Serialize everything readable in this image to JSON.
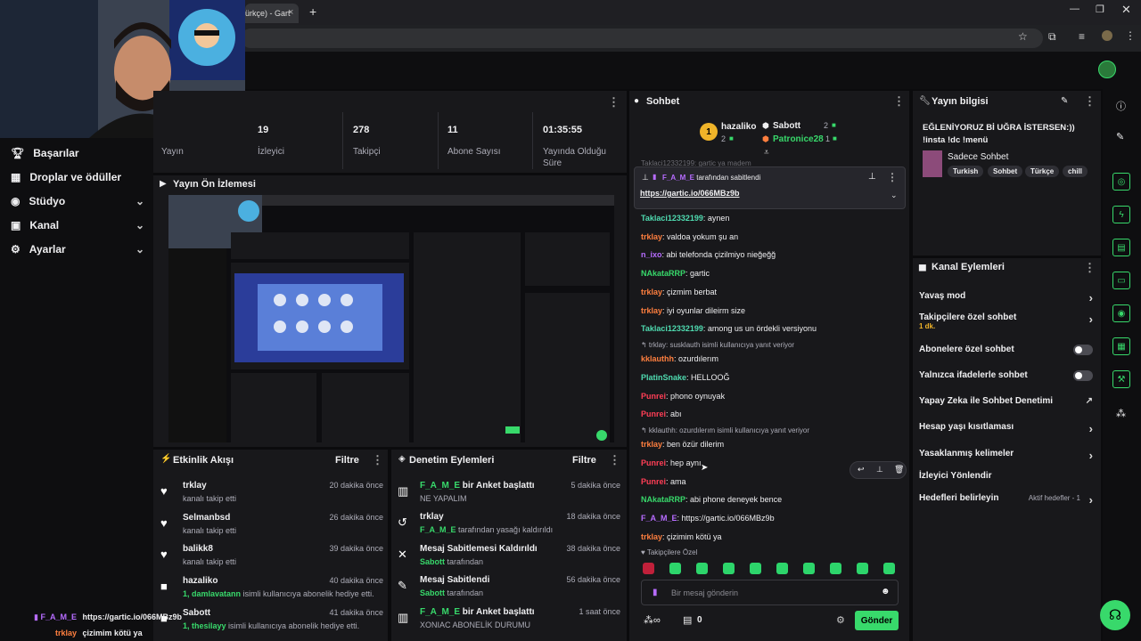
{
  "browser": {
    "tab_title": "ürkçe) - Gart",
    "new_tab": "+"
  },
  "left_nav": {
    "items": [
      {
        "label": "Başarılar",
        "icon": "trophy-icon"
      },
      {
        "label": "Droplar ve ödüller",
        "icon": "gift-icon"
      },
      {
        "label": "Stüdyo",
        "icon": "studio-icon",
        "chev": "⌄"
      },
      {
        "label": "Kanal",
        "icon": "channel-icon",
        "chev": "⌄"
      },
      {
        "label": "Ayarlar",
        "icon": "gear-icon",
        "chev": "⌄"
      }
    ]
  },
  "stats": {
    "stream_label": "Yayın",
    "items": [
      {
        "value": "19",
        "label": "İzleyici"
      },
      {
        "value": "278",
        "label": "Takipçi"
      },
      {
        "value": "11",
        "label": "Abone Sayısı"
      },
      {
        "value": "01:35:55",
        "label": "Yayında Olduğu Süre"
      }
    ]
  },
  "preview": {
    "title": "Yayın Ön İzlemesi"
  },
  "activity": {
    "title": "Etkinlik Akışı",
    "filter": "Filtre",
    "items": [
      {
        "name": "trklay",
        "sub": "kanalı takip etti",
        "time": "20 dakika önce"
      },
      {
        "name": "Selmanbsd",
        "sub": "kanalı takip etti",
        "time": "26 dakika önce"
      },
      {
        "name": "balikk8",
        "sub": "kanalı takip etti",
        "time": "39 dakika önce"
      },
      {
        "name": "hazaliko",
        "sub_a": "1, damlavatann",
        "sub_b": " isimli kullanıcıya abonelik hediye etti.",
        "time": "40 dakika önce"
      },
      {
        "name": "Sabott",
        "sub_a": "1, thesilayy",
        "sub_b": " isimli kullanıcıya abonelik hediye etti.",
        "time": "41 dakika önce"
      }
    ]
  },
  "moderation": {
    "title": "Denetim Eylemleri",
    "filter": "Filtre",
    "items": [
      {
        "name_a": "F_A_M_E",
        "name_b": " bir Anket başlattı",
        "sub": "NE YAPALIM",
        "time": "5 dakika önce"
      },
      {
        "name_a": "trklay",
        "name_b": "",
        "sub_a": "F_A_M_E",
        "sub_b": " tarafından yasağı kaldırıldı",
        "time": "18 dakika önce"
      },
      {
        "name_a": "Mesaj Sabitlemesi Kaldırıldı",
        "name_b": "",
        "sub_a": "Sabott",
        "sub_b": " tarafından",
        "time": "38 dakika önce"
      },
      {
        "name_a": "Mesaj Sabitlendi",
        "name_b": "",
        "sub_a": "Sabott",
        "sub_b": " tarafından",
        "time": "56 dakika önce"
      },
      {
        "name_a": "F_A_M_E",
        "name_b": " bir Anket başlattı",
        "sub": "XONIAC ABONELİK DURUMU",
        "time": "1 saat önce"
      }
    ]
  },
  "chat": {
    "title": "Sohbet",
    "top_gifters": [
      {
        "rank": "1",
        "name": "hazaliko",
        "count": "2"
      },
      {
        "name": "Sabott",
        "count": "2"
      },
      {
        "name": "Patronice28",
        "count": "1"
      }
    ],
    "pinned_by_name": "F_A_M_E",
    "pinned_by_text": " tarafından sabitlendi",
    "pinned_link": "https://gartic.io/066MBz9b",
    "top_fade": "Taklaci12332199: gartic ya madem",
    "messages": [
      {
        "user": "Taklaci12332199",
        "text": ": aynen",
        "c": "cyan"
      },
      {
        "user": "trklay",
        "text": ": valdoa yokum şu an",
        "c": "org"
      },
      {
        "user": "n_ixo",
        "text": ": abi telefonda çizilmiyo nieğeğğ",
        "c": "pur"
      },
      {
        "user": "NAkataRRP",
        "text": ": gartic",
        "c": "grn"
      },
      {
        "user": "trklay",
        "text": ": çizmim berbat",
        "c": "org"
      },
      {
        "user": "trklay",
        "text": ": iyi oyunlar dileirm size",
        "c": "org"
      },
      {
        "user": "Taklaci12332199",
        "text": ": among us un ördekli versiyonu",
        "c": "cyan"
      },
      {
        "reply": "↰ trklay: susklauth isimli kullanıcıya yanıt veriyor",
        "user": "kklauthh",
        "text": ": ozurdılerım",
        "c": "org"
      },
      {
        "user": "PlatinSnake",
        "text": ": HELLOOĞ",
        "c": "cyan"
      },
      {
        "user": "Punrei",
        "text": ": phono oynuyak",
        "c": "red"
      },
      {
        "user": "Punrei",
        "text": ": abı",
        "c": "red"
      },
      {
        "reply": "↰ kklauthh: ozurdılerım isimli kullanıcıya yanıt veriyor",
        "user": "trklay",
        "text": ": ben özür dilerim",
        "c": "org"
      },
      {
        "user": "Punrei",
        "text": ": hep aynı",
        "c": "red"
      },
      {
        "user": "Punrei",
        "text": ": ama",
        "c": "red"
      },
      {
        "user": "NAkataRRP",
        "text": ": abi phone deneyek bence",
        "c": "grn"
      },
      {
        "user": "F_A_M_E",
        "text": ": https://gartic.io/066MBz9b",
        "c": "pur"
      },
      {
        "user": "trklay",
        "text": ": çizimim kötü ya",
        "c": "org"
      }
    ],
    "emote_label": "Takipçilere Özel",
    "input_placeholder": "Bir mesaj gönderin",
    "points": "0",
    "send": "Gönder"
  },
  "info": {
    "title": "Yayın bilgisi",
    "stream_title": "EĞLENİYORUZ Bİ UĞRA İSTERSEN:)) !insta !dc !menü",
    "category": "Sadece Sohbet",
    "tags": [
      "Turkish",
      "Sohbet",
      "Türkçe",
      "chill"
    ]
  },
  "actions": {
    "title": "Kanal Eylemleri",
    "items": [
      {
        "label": "Yavaş mod",
        "ctrl": "chev"
      },
      {
        "label": "Takipçilere özel sohbet",
        "extra": "1 dk.",
        "ctrl": "chev"
      },
      {
        "label": "Abonelere özel sohbet",
        "ctrl": "toggle"
      },
      {
        "label": "Yalnızca ifadelerle sohbet",
        "ctrl": "toggle"
      },
      {
        "label": "Yapay Zeka ile Sohbet Denetimi",
        "ctrl": "ext"
      },
      {
        "label": "Hesap yaşı kısıtlaması",
        "ctrl": "chev"
      },
      {
        "label": "Yasaklanmış kelimeler",
        "ctrl": "chev"
      },
      {
        "label": "İzleyici Yönlendir",
        "ctrl": ""
      },
      {
        "label": "Hedefleri belirleyin",
        "extra": "Aktif hedefler - 1",
        "ctrl": "chev"
      }
    ]
  },
  "overlay": {
    "user1": "F_A_M_E",
    "msg1": "https://gartic.io/066MBz9b",
    "user2": "trklay",
    "msg2": "çizimim kötü ya"
  },
  "colors": {
    "accent": "#38d96b",
    "panel": "#18181b",
    "bg": "#0e0e10"
  }
}
